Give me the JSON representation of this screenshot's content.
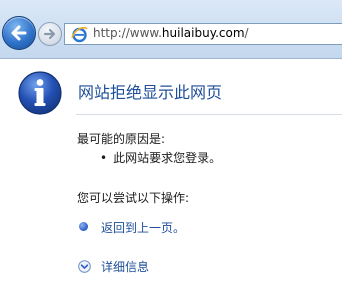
{
  "browser": {
    "back_button_icon": "back-arrow-icon",
    "forward_button_icon": "forward-arrow-icon",
    "address": {
      "prefix": "http://www.",
      "domain": "huilaibuy.com",
      "suffix": "/"
    }
  },
  "error_page": {
    "title": "网站拒绝显示此网页",
    "cause_heading": "最可能的原因是:",
    "causes": [
      "此网站要求您登录。"
    ],
    "try_heading": "您可以尝试以下操作:",
    "back_link": "返回到上一页。",
    "details_link": "详细信息",
    "colors": {
      "accent_blue": "#1e4e99",
      "text": "#1a1a1a"
    }
  }
}
